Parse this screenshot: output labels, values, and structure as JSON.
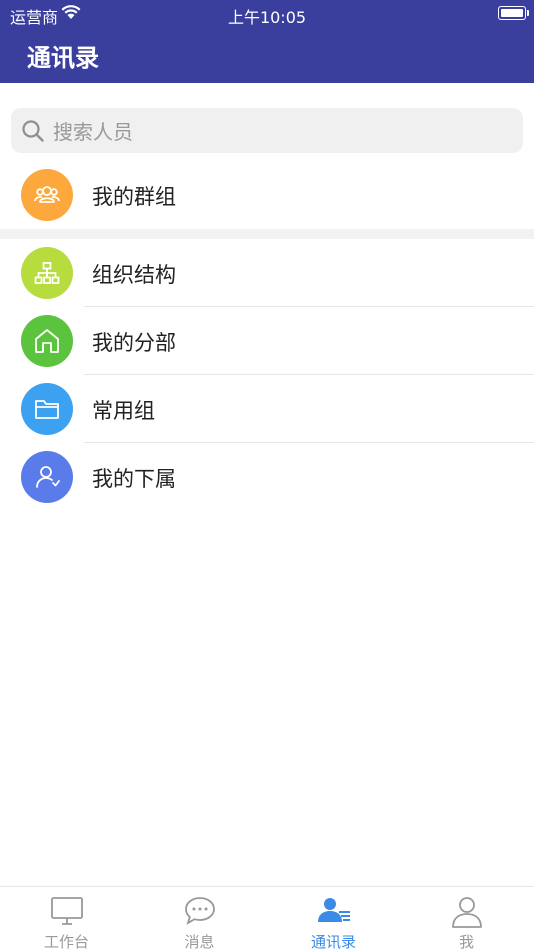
{
  "status_bar": {
    "carrier": "运营商",
    "time": "上午10:05"
  },
  "header": {
    "title": "通讯录"
  },
  "search": {
    "placeholder": "搜索人员",
    "value": ""
  },
  "groups": [
    {
      "label": "我的群组",
      "icon": "group-icon",
      "color": "#FDA83D"
    }
  ],
  "items": [
    {
      "label": "组织结构",
      "icon": "org-chart-icon",
      "color": "#B7DC3D"
    },
    {
      "label": "我的分部",
      "icon": "home-icon",
      "color": "#5BC33E"
    },
    {
      "label": "常用组",
      "icon": "folder-icon",
      "color": "#3DA1F2"
    },
    {
      "label": "我的下属",
      "icon": "subordinate-icon",
      "color": "#5A7CEB"
    }
  ],
  "tabs": [
    {
      "label": "工作台",
      "icon": "monitor-icon",
      "active": false
    },
    {
      "label": "消息",
      "icon": "chat-bubble-icon",
      "active": false
    },
    {
      "label": "通讯录",
      "icon": "contacts-icon",
      "active": true
    },
    {
      "label": "我",
      "icon": "person-icon",
      "active": false
    }
  ],
  "colors": {
    "header_bg": "#3A3F9D",
    "active_tab": "#3B8BE6",
    "inactive_tab": "#999999"
  }
}
